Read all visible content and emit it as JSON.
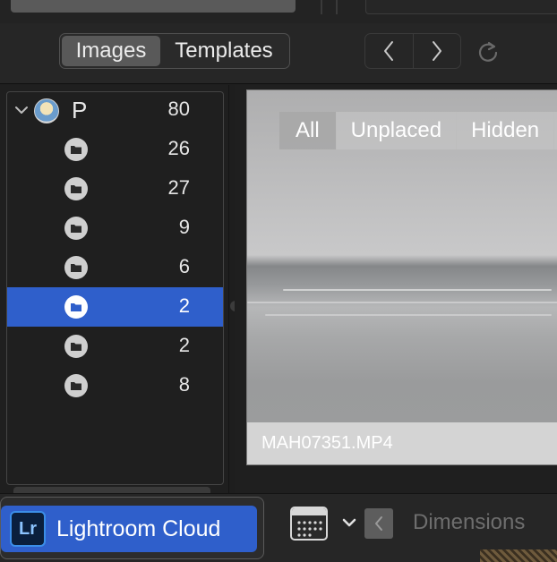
{
  "toolbar": {
    "tabs": [
      {
        "label": "Images",
        "active": true
      },
      {
        "label": "Templates",
        "active": false
      }
    ],
    "nav_back_icon": "chevron-left-icon",
    "nav_forward_icon": "chevron-right-icon",
    "reload_icon": "reload-icon"
  },
  "sidebar": {
    "root": {
      "label": "P",
      "count": "80",
      "expanded": true
    },
    "folders": [
      {
        "count": "26",
        "selected": false
      },
      {
        "count": "27",
        "selected": false
      },
      {
        "count": "9",
        "selected": false
      },
      {
        "count": "6",
        "selected": false
      },
      {
        "count": "2",
        "selected": true
      },
      {
        "count": "2",
        "selected": false
      },
      {
        "count": "8",
        "selected": false
      }
    ]
  },
  "preview": {
    "filters": [
      "All",
      "Unplaced",
      "Hidden"
    ],
    "active_filter": "All",
    "filename": "MAH07351.MP4"
  },
  "bottom": {
    "source_label": "Lightroom Cloud",
    "source_icon_text": "Lr",
    "back_icon": "chevron-left-icon",
    "sort_label": "Dimensions"
  },
  "colors": {
    "selection": "#2f5fcb",
    "background": "#1e1e1e"
  }
}
